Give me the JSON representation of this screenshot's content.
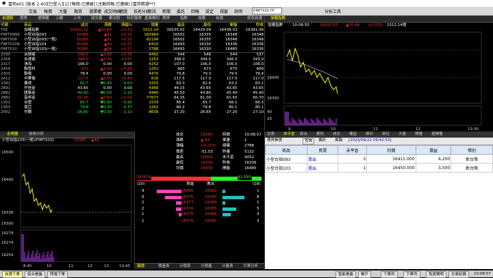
{
  "window": {
    "title": "富邦e01 [版本 2.40][已登入][1] [報價:已連線] [主動回報:已連線] [富邦精選**]",
    "controls": [
      "_",
      "□",
      "×"
    ]
  },
  "menu": {
    "items": [
      "交易",
      "報價",
      "大盤",
      "期貨",
      "選擇權",
      "成交明細",
      "權證",
      "技術分析",
      "資訊",
      "新聞",
      "委託",
      "回報",
      "設定",
      "視窗",
      "說明"
    ],
    "search_value": "FIMTX10.TF",
    "analysis_label": "分析工具"
  },
  "quote_panel": {
    "tabs": [
      "自選股",
      "期貨",
      "選擇權",
      "上櫃",
      "上市",
      "成交量",
      "戰法股",
      "特別報價",
      "產業類別",
      "期貨",
      "指數",
      "加權",
      "自選"
    ],
    "menu_tail": "修改自選",
    "headers": [
      "代碼",
      "商品",
      "成交",
      "漲跌",
      "漲幅%",
      "總量",
      "最高",
      "最低",
      "開盤",
      "昨收"
    ],
    "rows": [
      {
        "code": "TSE",
        "name": "加權指數",
        "price": "16431.52",
        "chg": "▲50.84",
        "pct": "+0.31",
        "vol": "1512.14",
        "high": "16535.02",
        "low": "16429.09",
        "open": "16436.03",
        "prev": "16381.49"
      },
      {
        "code": "FIMTX0N9",
        "name": "小型台指093",
        "price": "16389",
        "chg": "▲41",
        "pct": "+0.25",
        "vol": "182964",
        "high": "16502",
        "low": "16335",
        "open": "16348",
        "prev": "16348"
      },
      {
        "code": "FIMTX09",
        "name": "小型台指093(一般)",
        "price": "16389",
        "chg": "▲41",
        "pct": "+0.25",
        "vol": "82194",
        "high": "16502",
        "low": "16335",
        "open": "16348",
        "prev": "16348"
      },
      {
        "code": "FIMTX10N",
        "name": "小型台指103",
        "price": "16380",
        "chg": "▲44",
        "pct": "+0.27",
        "vol": "6410",
        "high": "16493",
        "low": "16330",
        "open": "16336",
        "prev": "16336"
      },
      {
        "code": "FIMTX10",
        "name": "小型台指103(一般)",
        "price": "16380",
        "chg": "▲44",
        "pct": "+0.27",
        "vol": "2788",
        "high": "16493",
        "low": "16330",
        "open": "16485",
        "prev": "16336"
      },
      {
        "code": "2330",
        "name": "台積電",
        "price": "546.0",
        "chg": "▲3.00",
        "pct": "+0.56",
        "vol": "4492",
        "high": "544",
        "low": "546",
        "open": "544",
        "prev": "537"
      },
      {
        "code": "2308",
        "name": "台達電",
        "price": "346.0",
        "chg": "▲3.00",
        "pct": "+0.87",
        "vol": "1253",
        "high": "348.0",
        "low": "344.5",
        "open": "346.5",
        "prev": "343.0"
      },
      {
        "code": "2317",
        "name": "鴻海",
        "price": "106.0",
        "chg": "0.00",
        "pct": "0.00",
        "vol": "4252",
        "high": "107.0",
        "low": "106.0",
        "open": "106.0",
        "prev": "106.0"
      },
      {
        "code": "2454",
        "name": "聯發科",
        "price": "673",
        "chg": "▲4.00",
        "pct": "+0.60",
        "vol": "1251",
        "high": "683",
        "low": "673",
        "open": "675",
        "prev": "669"
      },
      {
        "code": "2303",
        "name": "聯電",
        "price": "79.4",
        "chg": "0.00",
        "pct": "0.00",
        "vol": "4470",
        "high": "79.8",
        "low": "79.3",
        "open": "79.5",
        "prev": "79.4"
      },
      {
        "code": "2412",
        "name": "中華電",
        "price": "117.5",
        "chg": "▲0.50",
        "pct": "+0.43",
        "vol": "616",
        "high": "117.5",
        "low": "117.0",
        "open": "117.0",
        "prev": "117.0"
      },
      {
        "code": "2382",
        "name": "廣達",
        "price": "62.7",
        "chg": "▼0.40",
        "pct": "-0.63",
        "vol": "3325",
        "high": "63.3",
        "low": "62.6",
        "open": "63.2",
        "prev": "63.1"
      },
      {
        "code": "2891",
        "name": "中信金",
        "price": "43.65",
        "chg": "0.00",
        "pct": "0.00",
        "vol": "4366",
        "high": "44.15",
        "low": "43.65",
        "open": "43.65",
        "prev": "43.65"
      },
      {
        "code": "2882",
        "name": "國泰金",
        "price": "44.90",
        "chg": "▼0.50",
        "pct": "-1.10",
        "vol": "4440",
        "high": "45.50",
        "low": "44.80",
        "open": "45.45",
        "prev": "45.40"
      },
      {
        "code": "2881",
        "name": "富邦金",
        "price": "61.30",
        "chg": "▲0.60",
        "pct": "+1.02",
        "vol": "77077",
        "high": "64.25",
        "low": "61.00",
        "open": "61.50",
        "prev": "60.70"
      },
      {
        "code": "1301",
        "name": "台塑",
        "price": "65.7",
        "chg": "▼0.60",
        "pct": "-0.90",
        "vol": "1533",
        "high": "66.4",
        "low": "65.7",
        "open": "66.1",
        "prev": "66.3"
      },
      {
        "code": "1303",
        "name": "南亞",
        "price": "79.8",
        "chg": "▼0.30",
        "pct": "-0.37",
        "vol": "1262",
        "high": "80.2",
        "low": "79.8",
        "open": "80.1",
        "prev": "80.1"
      },
      {
        "code": "2002",
        "name": "中鋼",
        "price": "26.80",
        "chg": "▼0.30",
        "pct": "-1.11",
        "vol": "8639",
        "high": "27.20",
        "low": "26.65",
        "open": "27.20",
        "prev": "27.10"
      }
    ]
  },
  "index_chart": {
    "tab": "加權指數",
    "header": {
      "name": "加權指數",
      "time": "10:08:55",
      "price": "16431.53",
      "chg": "▲50.84",
      "pct": "+0.31%",
      "vol": "1512.14億"
    },
    "y_ticks": [
      "16400",
      "16350"
    ],
    "vol_ticks": [
      "40",
      "20"
    ],
    "x_ticks": [
      "9",
      "10",
      "11",
      "12",
      "13:30"
    ]
  },
  "futures_chart": {
    "tabs": [
      "走勢圖",
      "技術分析"
    ],
    "header": {
      "name": "小型台指103(一般)(FIMTX10)",
      "price": "16380",
      "chg": "▲44"
    },
    "y_ticks": [
      "16500",
      "16400",
      "16336",
      "16300",
      "16279"
    ],
    "vol_ticks": [
      "16274",
      "16254"
    ],
    "x_ticks": [
      "8:45",
      "10",
      "11",
      "12",
      "13",
      "13:45"
    ]
  },
  "detail": {
    "rows": [
      {
        "l": "成交",
        "v": "16380",
        "c": "▲",
        "r": "時間",
        "rv": "10:08:57"
      },
      {
        "l": "漲跌",
        "v": "▲ 44",
        "r": "單量",
        "rv": "1"
      },
      {
        "l": "漲幅",
        "v": "+0.27%",
        "r": "總量",
        "rv": "2788"
      },
      {
        "l": "價差",
        "v": "-51.53",
        "r": "昨量",
        "rv": "5132"
      },
      {
        "l": "最高",
        "v": "16493",
        "r": "未平倉",
        "rv": "4052"
      },
      {
        "l": "最低",
        "v": "16330",
        "r": "昨收",
        "rv": "16336"
      },
      {
        "l": "均價",
        "v": "16439",
        "r": "開盤",
        "rv": "16485"
      }
    ],
    "buy_pct": "58.91%",
    "sell_pct": "41.09%",
    "buy_label": "買進",
    "sell_label": "賣出",
    "buy_total": "(20)",
    "sell_total": "(18)",
    "book": [
      {
        "bq": "9",
        "bp": "16380",
        "sp": "16382",
        "sq": "1",
        "bw": 0.9,
        "sw": 0.1
      },
      {
        "bq": "6",
        "bp": "16376",
        "sp": "16383",
        "sq": "8",
        "bw": 0.6,
        "sw": 0.8
      },
      {
        "bq": "2",
        "bp": "16377",
        "sp": "16384",
        "sq": "1",
        "bw": 0.2,
        "sw": 0.1
      },
      {
        "bq": "2",
        "bp": "16376",
        "sp": "16385",
        "sq": "5",
        "bw": 0.2,
        "sw": 0.5
      },
      {
        "bq": "1",
        "bp": "16375",
        "sp": "16386",
        "sq": "3",
        "bw": 0.1,
        "sw": 0.3
      }
    ],
    "foot": {
      "l": "1",
      "bp": "16376",
      "sp": "16381",
      "r": "3"
    },
    "bottom_tabs": [
      "報價",
      "價量表",
      "分價表",
      "分價量",
      "分量表",
      "大單分析"
    ]
  },
  "orders": {
    "tabs": [
      "交易",
      "未平倉",
      "綜合",
      "委託",
      "成交",
      "權益",
      "庫存",
      "部位",
      "大盤",
      "期權",
      "選擇權"
    ],
    "toolbar": {
      "account": "期貨帳號",
      "query": "查詢",
      "cycle": "偏好",
      "window": "風報",
      "date": "[2023/08/22-09:42:53]"
    },
    "headers": [
      "商品",
      "買賣",
      "未平倉",
      "均價",
      "損益",
      "幣別"
    ],
    "rows": [
      {
        "name": "小型台指093",
        "side": "賣出",
        "qty": "3",
        "avg": "16415.000",
        "pnl": "4,200",
        "cur": "新台幣"
      },
      {
        "name": "小型台指103",
        "side": "賣出",
        "qty": "1",
        "avg": "16450.000",
        "pnl": "3,500",
        "cur": "新台幣"
      }
    ]
  },
  "statusbar": {
    "left": [
      "自選下單",
      "綜合看盤",
      "閃電下單"
    ],
    "right": [
      "智能看盤",
      "帳戶",
      "下單列",
      "下單列",
      "免責聲明",
      "交易紀錄"
    ],
    "time": "10:08:57"
  },
  "colors": {
    "up": "#ff3030",
    "down": "#20ff20",
    "flat": "#ffffff",
    "accent": "#ffff00"
  }
}
